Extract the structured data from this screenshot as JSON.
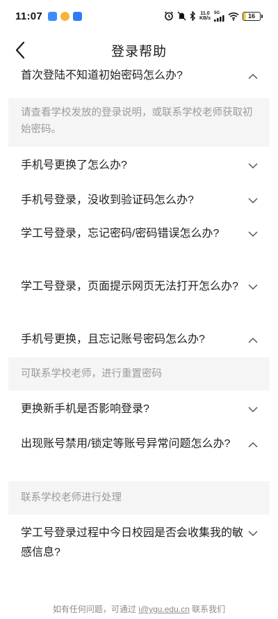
{
  "status_bar": {
    "time": "11:07",
    "net_speed_top": "11.0",
    "net_speed_bottom": "KB/s",
    "signal_label": "5G",
    "battery_level": "16",
    "battery_fraction": 0.16
  },
  "header": {
    "title": "登录帮助"
  },
  "faq": [
    {
      "question": "首次登陆不知道初始密码怎么办?",
      "expanded": true,
      "answer": "请查看学校发放的登录说明，或联系学校老师获取初始密码。"
    },
    {
      "question": "手机号更换了怎么办?",
      "expanded": false
    },
    {
      "question": "手机号登录，没收到验证码怎么办?",
      "expanded": false
    },
    {
      "question": "学工号登录，忘记密码/密码错误怎么办?",
      "expanded": false
    },
    {
      "question": "学工号登录，页面提示网页无法打开怎么办?",
      "expanded": false
    },
    {
      "question": "手机号更换，且忘记账号密码怎么办?",
      "expanded": true,
      "answer": "可联系学校老师，进行重置密码"
    },
    {
      "question": "更换新手机是否影响登录?",
      "expanded": false
    },
    {
      "question": "出现账号禁用/锁定等账号异常问题怎么办?",
      "expanded": true,
      "answer": "联系学校老师进行处理"
    },
    {
      "question": "学工号登录过程中今日校园是否会收集我的敏感信息?",
      "expanded": false
    }
  ],
  "footer": {
    "prefix": "如有任何问题，可通过",
    "email": "i@ygu.edu.cn",
    "suffix": "联系我们"
  }
}
